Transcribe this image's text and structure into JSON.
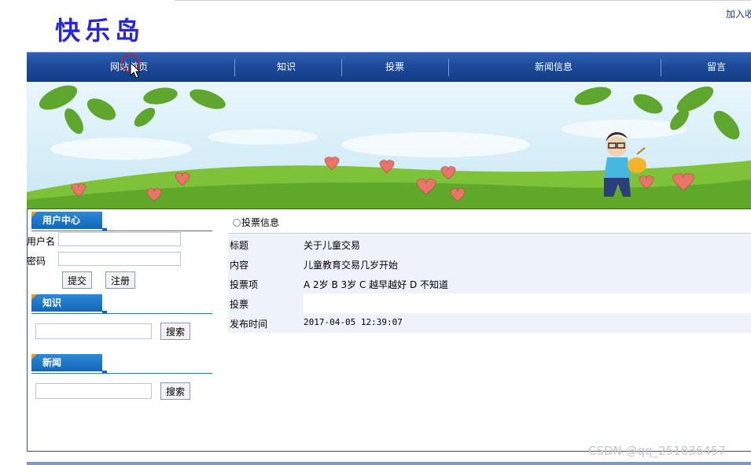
{
  "site": {
    "logo": "快乐岛",
    "fav_link": "加入收"
  },
  "nav": {
    "items": [
      "网站首页",
      "知识",
      "投票",
      "新闻信息",
      "留言"
    ]
  },
  "user_center": {
    "title": "用户中心",
    "username_label": "用户名",
    "username_value": "",
    "password_label": "密码",
    "password_value": "",
    "submit_label": "提交",
    "register_label": "注册"
  },
  "knowledge": {
    "title": "知识",
    "search_value": "",
    "search_label": "搜索"
  },
  "news": {
    "title": "新闻",
    "search_value": "",
    "search_label": "搜索"
  },
  "vote": {
    "header": "投票信息",
    "rows": [
      {
        "label": "标题",
        "value": "关于儿童交易"
      },
      {
        "label": "内容",
        "value": "儿童教育交易几岁开始"
      },
      {
        "label": "投票项",
        "value": "A 2岁 B 3岁 C 越早越好 D 不知道"
      },
      {
        "label": "投票",
        "value": ""
      },
      {
        "label": "发布时间",
        "value": "2017-04-05 12:39:07"
      }
    ]
  },
  "watermark": "CSDN @qq_251836457",
  "colors": {
    "nav": "#1d4a9a",
    "accent": "#1166b8",
    "logo": "#2727d8",
    "row_alt": "#eef2fa"
  }
}
